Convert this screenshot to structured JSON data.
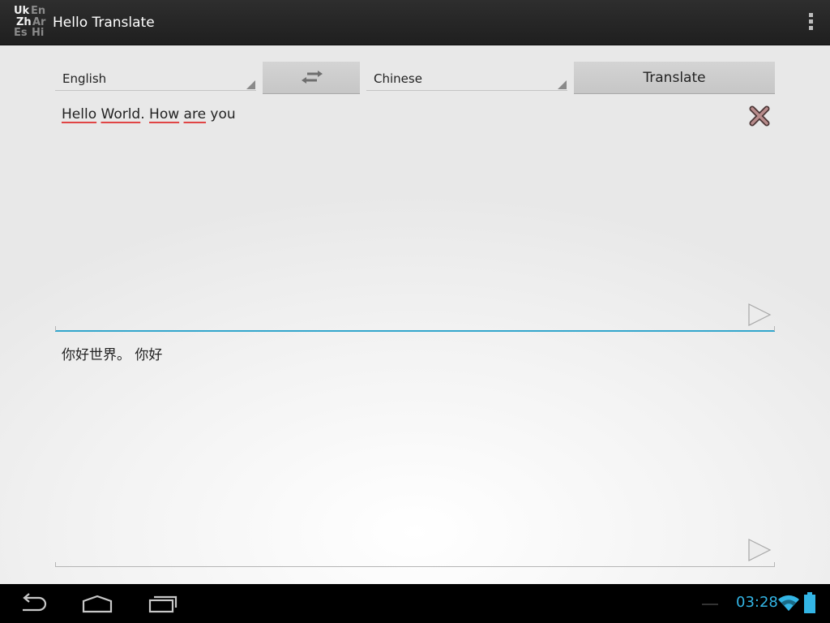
{
  "app": {
    "title": "Hello Translate",
    "logo_letters": [
      "Uk",
      "En",
      "Zh",
      "Ar",
      "Es",
      "Hi"
    ],
    "logo_icon": "language-logo-icon",
    "menu_icon": "overflow-menu-icon"
  },
  "toolbar": {
    "source_language": "English",
    "target_language": "Chinese",
    "swap_icon": "swap-arrows-icon",
    "translate_label": "Translate"
  },
  "source_field": {
    "words": [
      "Hello",
      " ",
      "World",
      ". ",
      "How",
      " ",
      "are",
      " you"
    ],
    "misspelled_word_indices": [
      0,
      2,
      4,
      6
    ],
    "clear_icon": "clear-x-icon",
    "speak_icon": "play-speak-icon"
  },
  "result_field": {
    "text": "你好世界。 你好",
    "speak_icon": "play-speak-icon"
  },
  "system_bar": {
    "time": "03:28",
    "nav_icons": [
      "back-icon",
      "home-icon",
      "recent-apps-icon"
    ],
    "status_icons": [
      "wifi-icon",
      "battery-icon"
    ]
  },
  "colors": {
    "accent": "#33b5e5",
    "spellcheck": "#e04545",
    "action_bar": "#282828",
    "button": "#cdcdcd"
  }
}
